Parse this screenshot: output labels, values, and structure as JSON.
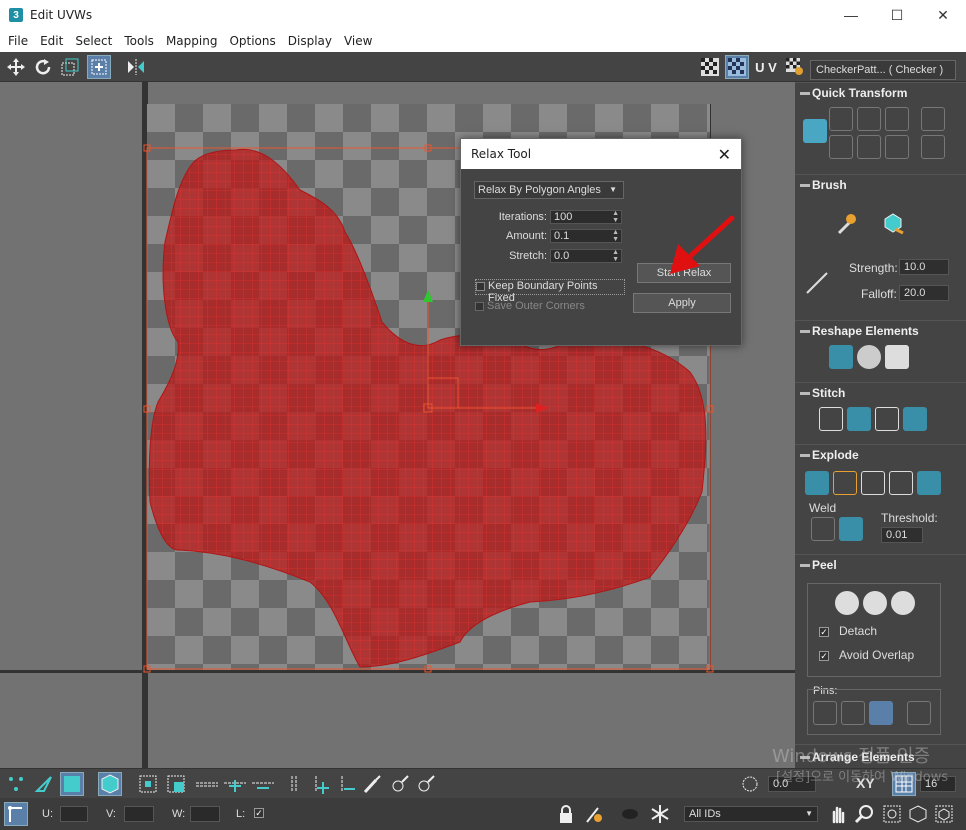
{
  "window": {
    "title": "Edit UVWs",
    "badge": "3",
    "minimize": "—",
    "maximize": "☐",
    "close": "✕"
  },
  "menu": [
    "File",
    "Edit",
    "Select",
    "Tools",
    "Mapping",
    "Options",
    "Display",
    "View"
  ],
  "toolbar": {
    "uv_label": "U V",
    "checker_select": "CheckerPatt... ( Checker )"
  },
  "dialog": {
    "title": "Relax Tool",
    "close": "✕",
    "method": "Relax By Polygon Angles",
    "iterations_label": "Iterations:",
    "iterations": "100",
    "amount_label": "Amount:",
    "amount": "0.1",
    "stretch_label": "Stretch:",
    "stretch": "0.0",
    "keep_boundary": "Keep Boundary Points Fixed",
    "save_outer": "Save Outer Corners",
    "start_relax": "Start Relax",
    "apply": "Apply"
  },
  "panel": {
    "quick_transform": "Quick Transform",
    "brush": "Brush",
    "strength_label": "Strength:",
    "strength": "10.0",
    "falloff_label": "Falloff:",
    "falloff": "20.0",
    "reshape": "Reshape Elements",
    "stitch": "Stitch",
    "explode": "Explode",
    "weld": "Weld",
    "threshold_label": "Threshold:",
    "threshold": "0.01",
    "peel": "Peel",
    "detach": "Detach",
    "avoid_overlap": "Avoid Overlap",
    "pins": "Pins:",
    "arrange": "Arrange Elements"
  },
  "bottom": {
    "u_label": "U:",
    "v_label": "V:",
    "w_label": "W:",
    "l_label": "L:",
    "xy": "XY",
    "rotation": "0.0",
    "grid": "16",
    "ids": "All IDs"
  },
  "watermark": {
    "line1": "Windows 정품 인증",
    "line2": "[설정]으로 이동하여 Windows"
  },
  "colors": {
    "uv_mesh": "#c11a1a",
    "gizmo": "#e8552e",
    "panel_bg": "#444444",
    "active_btn": "#5a7fa8"
  }
}
